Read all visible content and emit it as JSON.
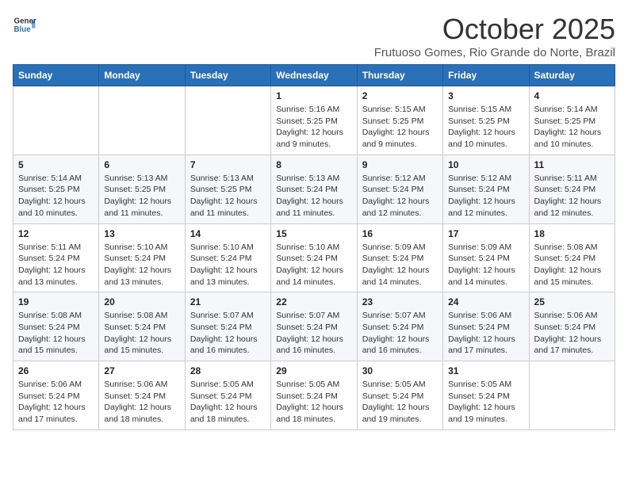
{
  "logo": {
    "general": "General",
    "blue": "Blue"
  },
  "header": {
    "month": "October 2025",
    "location": "Frutuoso Gomes, Rio Grande do Norte, Brazil"
  },
  "weekdays": [
    "Sunday",
    "Monday",
    "Tuesday",
    "Wednesday",
    "Thursday",
    "Friday",
    "Saturday"
  ],
  "weeks": [
    [
      {
        "day": "",
        "info": ""
      },
      {
        "day": "",
        "info": ""
      },
      {
        "day": "",
        "info": ""
      },
      {
        "day": "1",
        "info": "Sunrise: 5:16 AM\nSunset: 5:25 PM\nDaylight: 12 hours and 9 minutes."
      },
      {
        "day": "2",
        "info": "Sunrise: 5:15 AM\nSunset: 5:25 PM\nDaylight: 12 hours and 9 minutes."
      },
      {
        "day": "3",
        "info": "Sunrise: 5:15 AM\nSunset: 5:25 PM\nDaylight: 12 hours and 10 minutes."
      },
      {
        "day": "4",
        "info": "Sunrise: 5:14 AM\nSunset: 5:25 PM\nDaylight: 12 hours and 10 minutes."
      }
    ],
    [
      {
        "day": "5",
        "info": "Sunrise: 5:14 AM\nSunset: 5:25 PM\nDaylight: 12 hours and 10 minutes."
      },
      {
        "day": "6",
        "info": "Sunrise: 5:13 AM\nSunset: 5:25 PM\nDaylight: 12 hours and 11 minutes."
      },
      {
        "day": "7",
        "info": "Sunrise: 5:13 AM\nSunset: 5:25 PM\nDaylight: 12 hours and 11 minutes."
      },
      {
        "day": "8",
        "info": "Sunrise: 5:13 AM\nSunset: 5:24 PM\nDaylight: 12 hours and 11 minutes."
      },
      {
        "day": "9",
        "info": "Sunrise: 5:12 AM\nSunset: 5:24 PM\nDaylight: 12 hours and 12 minutes."
      },
      {
        "day": "10",
        "info": "Sunrise: 5:12 AM\nSunset: 5:24 PM\nDaylight: 12 hours and 12 minutes."
      },
      {
        "day": "11",
        "info": "Sunrise: 5:11 AM\nSunset: 5:24 PM\nDaylight: 12 hours and 12 minutes."
      }
    ],
    [
      {
        "day": "12",
        "info": "Sunrise: 5:11 AM\nSunset: 5:24 PM\nDaylight: 12 hours and 13 minutes."
      },
      {
        "day": "13",
        "info": "Sunrise: 5:10 AM\nSunset: 5:24 PM\nDaylight: 12 hours and 13 minutes."
      },
      {
        "day": "14",
        "info": "Sunrise: 5:10 AM\nSunset: 5:24 PM\nDaylight: 12 hours and 13 minutes."
      },
      {
        "day": "15",
        "info": "Sunrise: 5:10 AM\nSunset: 5:24 PM\nDaylight: 12 hours and 14 minutes."
      },
      {
        "day": "16",
        "info": "Sunrise: 5:09 AM\nSunset: 5:24 PM\nDaylight: 12 hours and 14 minutes."
      },
      {
        "day": "17",
        "info": "Sunrise: 5:09 AM\nSunset: 5:24 PM\nDaylight: 12 hours and 14 minutes."
      },
      {
        "day": "18",
        "info": "Sunrise: 5:08 AM\nSunset: 5:24 PM\nDaylight: 12 hours and 15 minutes."
      }
    ],
    [
      {
        "day": "19",
        "info": "Sunrise: 5:08 AM\nSunset: 5:24 PM\nDaylight: 12 hours and 15 minutes."
      },
      {
        "day": "20",
        "info": "Sunrise: 5:08 AM\nSunset: 5:24 PM\nDaylight: 12 hours and 15 minutes."
      },
      {
        "day": "21",
        "info": "Sunrise: 5:07 AM\nSunset: 5:24 PM\nDaylight: 12 hours and 16 minutes."
      },
      {
        "day": "22",
        "info": "Sunrise: 5:07 AM\nSunset: 5:24 PM\nDaylight: 12 hours and 16 minutes."
      },
      {
        "day": "23",
        "info": "Sunrise: 5:07 AM\nSunset: 5:24 PM\nDaylight: 12 hours and 16 minutes."
      },
      {
        "day": "24",
        "info": "Sunrise: 5:06 AM\nSunset: 5:24 PM\nDaylight: 12 hours and 17 minutes."
      },
      {
        "day": "25",
        "info": "Sunrise: 5:06 AM\nSunset: 5:24 PM\nDaylight: 12 hours and 17 minutes."
      }
    ],
    [
      {
        "day": "26",
        "info": "Sunrise: 5:06 AM\nSunset: 5:24 PM\nDaylight: 12 hours and 17 minutes."
      },
      {
        "day": "27",
        "info": "Sunrise: 5:06 AM\nSunset: 5:24 PM\nDaylight: 12 hours and 18 minutes."
      },
      {
        "day": "28",
        "info": "Sunrise: 5:05 AM\nSunset: 5:24 PM\nDaylight: 12 hours and 18 minutes."
      },
      {
        "day": "29",
        "info": "Sunrise: 5:05 AM\nSunset: 5:24 PM\nDaylight: 12 hours and 18 minutes."
      },
      {
        "day": "30",
        "info": "Sunrise: 5:05 AM\nSunset: 5:24 PM\nDaylight: 12 hours and 19 minutes."
      },
      {
        "day": "31",
        "info": "Sunrise: 5:05 AM\nSunset: 5:24 PM\nDaylight: 12 hours and 19 minutes."
      },
      {
        "day": "",
        "info": ""
      }
    ]
  ]
}
